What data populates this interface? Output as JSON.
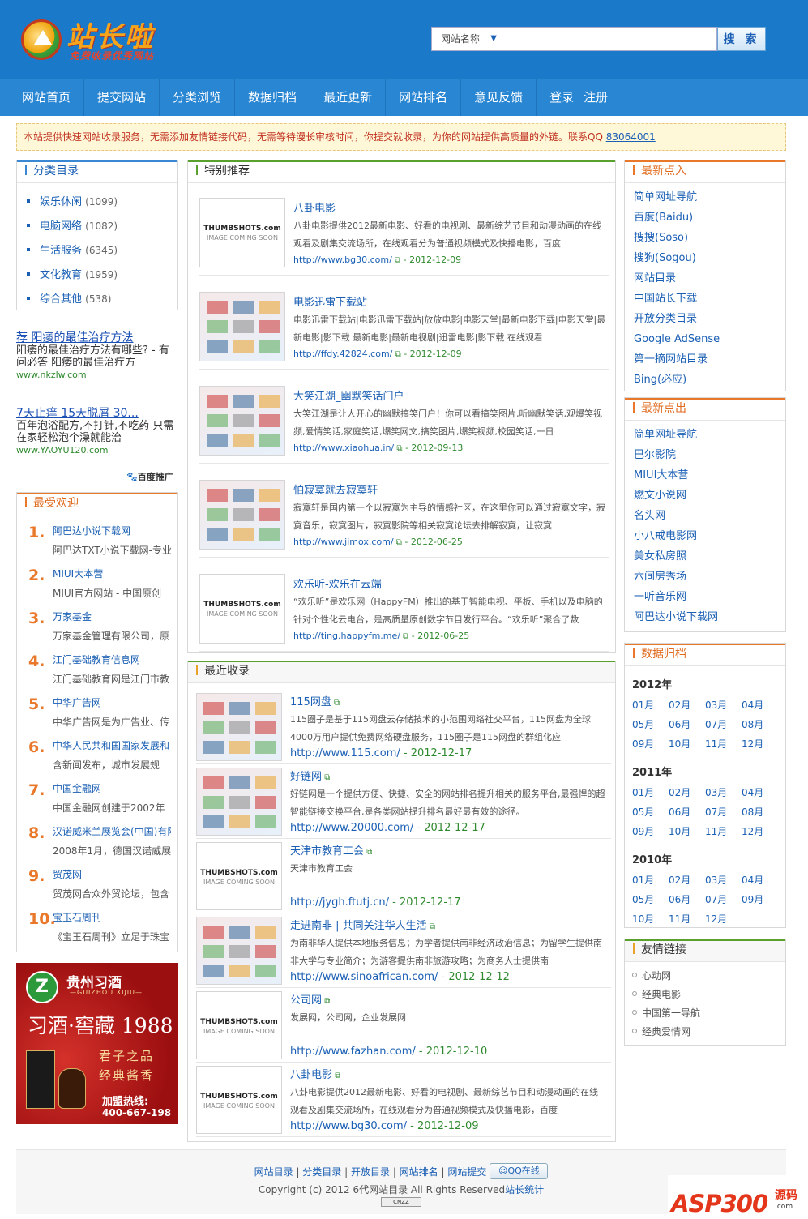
{
  "header": {
    "logo_name": "站长啦",
    "logo_slogan": "免费收录优秀网站",
    "search_select": "网站名称",
    "search_placeholder": "",
    "search_button": "搜 索"
  },
  "nav": [
    "网站首页",
    "提交网站",
    "分类浏览",
    "数据归档",
    "最近更新",
    "网站排名",
    "意见反馈"
  ],
  "nav_login": "登录",
  "nav_register": "注册",
  "notice": {
    "text": "本站提供快速网站收录服务，无需添加友情链接代码，无需等待漫长审核时间，你提交就收录，为你的网站提供高质量的外链。联系QQ ",
    "qq": "83064001"
  },
  "categories": {
    "title": "分类目录",
    "items": [
      {
        "name": "娱乐休闲",
        "count": "(1099)"
      },
      {
        "name": "电脑网络",
        "count": "(1082)"
      },
      {
        "name": "生活服务",
        "count": "(6345)"
      },
      {
        "name": "文化教育",
        "count": "(1959)"
      },
      {
        "name": "综合其他",
        "count": "(538)"
      }
    ]
  },
  "ads": [
    {
      "title": "荐 阳痿的最佳治疗方法",
      "desc": "阳痿的最佳治疗方法有哪些? - 有问必答 阳痿的最佳治疗方",
      "url": "www.nkzlw.com"
    },
    {
      "title": "7天止痒 15天脱屑 30...",
      "desc": "百年泡浴配方,不打针,不吃药 只需在家轻松泡个澡就能治",
      "url": "www.YAOYU120.com"
    }
  ],
  "baidu_label": "百度推广",
  "popular": {
    "title": "最受欢迎",
    "items": [
      {
        "n": "1.",
        "title": "阿巴达小说下载网",
        "desc": "阿巴达TXT小说下载网-专业"
      },
      {
        "n": "2.",
        "title": "MIUI大本营",
        "desc": "MIUI官方网站 - 中国原创"
      },
      {
        "n": "3.",
        "title": "万家基金",
        "desc": "万家基金管理有限公司，原"
      },
      {
        "n": "4.",
        "title": "江门基础教育信息网",
        "desc": "江门基础教育网是江门市教"
      },
      {
        "n": "5.",
        "title": "中华广告网",
        "desc": "中华广告网是为广告业、传"
      },
      {
        "n": "6.",
        "title": "中华人民共和国国家发展和",
        "desc": "含新闻发布，城市发展规"
      },
      {
        "n": "7.",
        "title": "中国金融网",
        "desc": "中国金融网创建于2002年"
      },
      {
        "n": "8.",
        "title": "汉诺威米兰展览会(中国)有限",
        "desc": "2008年1月，德国汉诺威展"
      },
      {
        "n": "9.",
        "title": "贸茂网",
        "desc": "贸茂网合众外贸论坛，包含"
      },
      {
        "n": "10.",
        "title": "宝玉石周刊",
        "desc": "《宝玉石周刊》立足于珠宝"
      }
    ]
  },
  "wine_ad": {
    "brand": "贵州习酒",
    "brand_en": "—GUIZHOU XIJIU—",
    "headline": "习酒·窖藏 1988",
    "line1": "君子之品",
    "line2": "经典酱香",
    "hotline": "加盟热线:",
    "phone": "400-667-198"
  },
  "recommend": {
    "title": "特别推荐",
    "items": [
      {
        "thumb": "placeholder",
        "title": "八卦电影",
        "desc": "八卦电影提供2012最新电影、好看的电视剧、最新综艺节目和动漫动画的在线观看及剧集交流场所，在线观看分为普通视频模式及快播电影，百度",
        "url": "http://www.bg30.com/",
        "date": " - 2012-12-09"
      },
      {
        "thumb": "image",
        "title": "电影迅雷下载站",
        "desc": "电影迅雷下载站|电影迅雷下载站|放放电影|电影天堂|最新电影下载|电影天堂|最新电影|影下载 最新电影|最新电视剧|迅雷电影|影下载 在线观看",
        "url": "http://ffdy.42824.com/",
        "date": " - 2012-12-09"
      },
      {
        "thumb": "image",
        "title": "大笑江湖_幽默笑话门户",
        "desc": "大笑江湖是让人开心的幽默搞笑门户！你可以看搞笑图片,听幽默笑话,观爆笑视频,爱情笑话,家庭笑话,爆笑网文,搞笑图片,爆笑视频,校园笑话,一日",
        "url": "http://www.xiaohua.in/",
        "date": " - 2012-09-13"
      },
      {
        "thumb": "image",
        "title": "怕寂寞就去寂寞轩",
        "desc": "寂寞轩是国内第一个以寂寞为主导的情感社区，在这里你可以通过寂寞文字，寂寞音乐，寂寞图片，寂寞影院等相关寂寞论坛去排解寂寞，让寂寞",
        "url": "http://www.jimox.com/",
        "date": " - 2012-06-25"
      },
      {
        "thumb": "placeholder",
        "title": "欢乐听-欢乐在云端",
        "desc": "“欢乐听”是欢乐网（HappyFM）推出的基于智能电视、平板、手机以及电脑的针对个性化云电台，是高质量原创数字节目发行平台。“欢乐听”聚合了数",
        "url": "http://ting.happyfm.me/",
        "date": " - 2012-06-25"
      }
    ]
  },
  "latest": {
    "title": "最近收录",
    "items": [
      {
        "thumb": "image",
        "title": "115网盘",
        "desc": "115圈子是基于115网盘云存储技术的小范围网络社交平台，115网盘为全球4000万用户提供免费网络硬盘服务，115圈子是115网盘的群组化应",
        "url": "http://www.115.com/",
        "date": " - 2012-12-17"
      },
      {
        "thumb": "image",
        "title": "好链网",
        "desc": "好链网是一个提供方便、快捷、安全的网站排名提升相关的服务平台,最强悍的超智能链接交换平台,是各类网站提升排名最好最有效的途径。",
        "url": "http://www.20000.com/",
        "date": " - 2012-12-17"
      },
      {
        "thumb": "placeholder",
        "title": "天津市教育工会",
        "desc": "天津市教育工会",
        "url": "http://jygh.ftutj.cn/",
        "date": " - 2012-12-17"
      },
      {
        "thumb": "image",
        "title": "走进南非 | 共同关注华人生活",
        "desc": "为南非华人提供本地服务信息；为学者提供南非经济政治信息；为留学生提供南非大学与专业简介；为游客提供南非旅游攻略；为商务人士提供南",
        "url": "http://www.sinoafrican.com/",
        "date": " - 2012-12-12"
      },
      {
        "thumb": "placeholder",
        "title": "公司网",
        "desc": "发展网，公司网，企业发展网",
        "url": "http://www.fazhan.com/",
        "date": " - 2012-12-10"
      },
      {
        "thumb": "placeholder",
        "title": "八卦电影",
        "desc": "八卦电影提供2012最新电影、好看的电视剧、最新综艺节目和动漫动画的在线观看及剧集交流场所，在线观看分为普通视频模式及快播电影，百度",
        "url": "http://www.bg30.com/",
        "date": " - 2012-12-09"
      }
    ]
  },
  "thumbshot": {
    "brand": "THUMBSHOTS.com",
    "sub": "IMAGE COMING SOON"
  },
  "latest_click": {
    "title": "最新点入",
    "items": [
      "简单网址导航",
      "百度(Baidu)",
      "搜搜(Soso)",
      "搜狗(Sogou)",
      "网站目录",
      "中国站长下载",
      "开放分类目录",
      "Google AdSense",
      "第一摘网站目录",
      "Bing(必应)"
    ]
  },
  "latest_out": {
    "title": "最新点出",
    "items": [
      "简单网址导航",
      "巴尔影院",
      "MIUI大本营",
      "燃文小说网",
      "名头网",
      "小八戒电影网",
      "美女私房照",
      "六间房秀场",
      "一听音乐网",
      "阿巴达小说下载网"
    ]
  },
  "archive": {
    "title": "数据归档",
    "years": [
      {
        "year": "2012年",
        "months": [
          "01月",
          "02月",
          "03月",
          "04月",
          "05月",
          "06月",
          "07月",
          "08月",
          "09月",
          "10月",
          "11月",
          "12月"
        ]
      },
      {
        "year": "2011年",
        "months": [
          "01月",
          "02月",
          "03月",
          "04月",
          "05月",
          "06月",
          "07月",
          "08月",
          "09月",
          "10月",
          "11月",
          "12月"
        ]
      },
      {
        "year": "2010年",
        "months": [
          "01月",
          "02月",
          "03月",
          "04月",
          "05月",
          "06月",
          "07月",
          "09月",
          "10月",
          "11月",
          "12月"
        ]
      }
    ]
  },
  "friends": {
    "title": "友情链接",
    "items": [
      "心动网",
      "经典电影",
      "中国第一导航",
      "经典爱情网"
    ]
  },
  "footer": {
    "links": [
      "网站目录",
      "分类目录",
      "开放目录",
      "网站排名",
      "网站提交"
    ],
    "qq": "QQ在线",
    "copyright": "Copyright (c) 2012 6代网站目录 All Rights Reserved",
    "stats": "站长统计",
    "cnzz": "CNZZ"
  },
  "watermark": {
    "name": "ASP300",
    "suffix": "源码",
    "domain": ".com"
  }
}
